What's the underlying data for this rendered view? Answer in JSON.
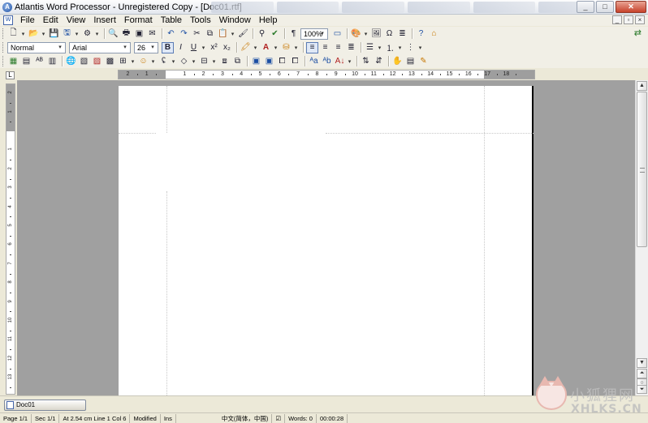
{
  "window": {
    "title": "Atlantis Word Processor - Unregistered Copy - [Doc01.rtf]",
    "buttons": {
      "minimize": "_",
      "maximize": "□",
      "close": "✕"
    }
  },
  "menu": {
    "items": [
      "File",
      "Edit",
      "View",
      "Insert",
      "Format",
      "Table",
      "Tools",
      "Window",
      "Help"
    ]
  },
  "formatting": {
    "style": "Normal",
    "font": "Arial",
    "size": "26",
    "zoom": "100%",
    "bold": "B",
    "italic": "I",
    "underline": "U"
  },
  "ruler": {
    "h_numbers": [
      "2",
      "1",
      "1",
      "2",
      "3",
      "4",
      "5",
      "6",
      "7",
      "8",
      "9",
      "10",
      "11",
      "12",
      "13",
      "14",
      "15",
      "16",
      "17",
      "18"
    ],
    "v_numbers": [
      "2",
      "1",
      "1",
      "2",
      "3",
      "4",
      "5",
      "6",
      "7",
      "8",
      "9",
      "10",
      "11",
      "12",
      "13"
    ]
  },
  "document_tab": {
    "label": "Doc01"
  },
  "status": {
    "page": "Page 1/1",
    "section": "Sec 1/1",
    "position": "At 2.54 cm",
    "line": "Line 1",
    "col": "Col 6",
    "modified": "Modified",
    "ins": "Ins",
    "language": "中文(简体，中国)",
    "words": "Words: 0",
    "time": "00:00:28"
  },
  "watermark": {
    "text": "小狐狸网",
    "sub": "XHLKS.CN"
  }
}
